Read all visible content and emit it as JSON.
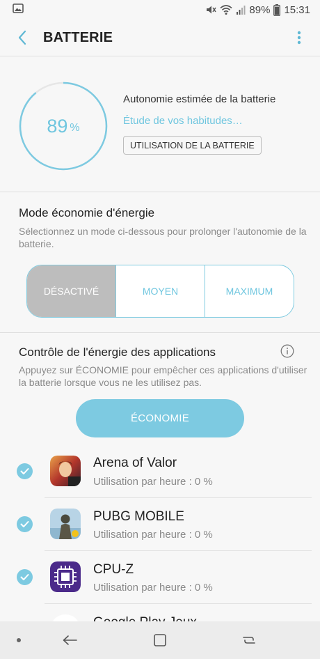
{
  "status": {
    "battery_pct": "89%",
    "time": "15:31"
  },
  "header": {
    "title": "BATTERIE"
  },
  "battery": {
    "level_value": "89",
    "level_unit": "%",
    "level_fraction": 0.89,
    "estimate_label": "Autonomie estimée de la batterie",
    "study_text": "Étude de vos habitudes…",
    "usage_button": "UTILISATION DE LA BATTERIE"
  },
  "power_mode": {
    "title": "Mode économie d'énergie",
    "description": "Sélectionnez un mode ci-dessous pour prolonger l'autonomie de la batterie.",
    "options": [
      "DÉSACTIVÉ",
      "MOYEN",
      "MAXIMUM"
    ],
    "selected": "DÉSACTIVÉ"
  },
  "app_control": {
    "title": "Contrôle de l'énergie des applications",
    "description": "Appuyez sur ÉCONOMIE pour empêcher ces applications d'utiliser la batterie lorsque vous ne les utilisez pas.",
    "economy_button": "ÉCONOMIE",
    "apps": [
      {
        "name": "Arena of Valor",
        "usage": "Utilisation par heure : 0 %",
        "checked": true
      },
      {
        "name": "PUBG MOBILE",
        "usage": "Utilisation par heure : 0 %",
        "checked": true
      },
      {
        "name": "CPU-Z",
        "usage": "Utilisation par heure : 0 %",
        "checked": true
      },
      {
        "name": "Google Play Jeux",
        "usage": "",
        "checked": true
      }
    ]
  },
  "colors": {
    "accent": "#7dcae1",
    "ring_track": "#e6e6e6",
    "selected_mode": "#bdbdbd"
  }
}
